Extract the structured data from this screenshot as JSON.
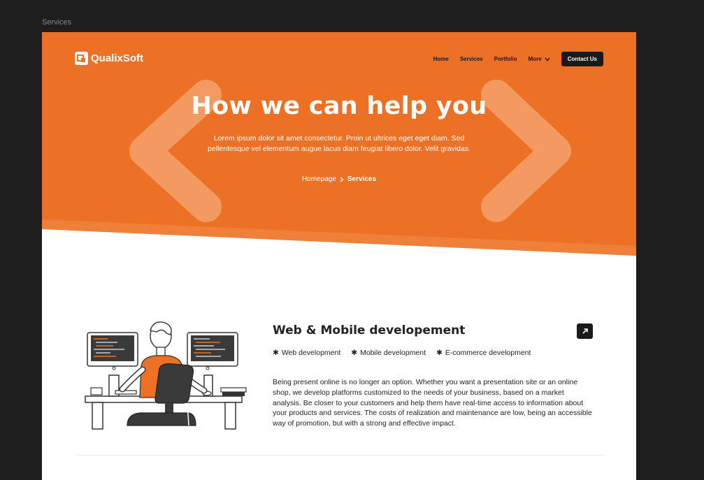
{
  "canvas": {
    "label": "Services"
  },
  "colors": {
    "accent": "#ec7125",
    "dark": "#1a1a1a",
    "chevron": "#f29a62"
  },
  "brand": {
    "name": "QualixSoft"
  },
  "nav": {
    "items": [
      "Home",
      "Services",
      "Portfolio",
      "More"
    ],
    "cta": "Contact Us"
  },
  "hero": {
    "title": "How we can help you",
    "subtitle": "Lorem ipsum dolor sit amet consectetur. Proin ut ultrices eget eget diam. Sed pellentesque vel elementum augue lacus diam feugiat libero dolor. Velit gravidas.",
    "breadcrumb": {
      "home": "Homepage",
      "current": "Services"
    }
  },
  "service": {
    "title": "Web & Mobile developement",
    "tags": [
      "Web development",
      "Mobile development",
      "E-commerce development"
    ],
    "description": "Being present online is no longer an option. Whether you want a presentation site or an online shop, we develop platforms customized to the needs of your business, based on a market analysis. Be closer to your customers and help them have real-time access to information about your products and services. The costs of realization and maintenance are low, being an accessible way of promotion, but with a strong and effective impact."
  }
}
